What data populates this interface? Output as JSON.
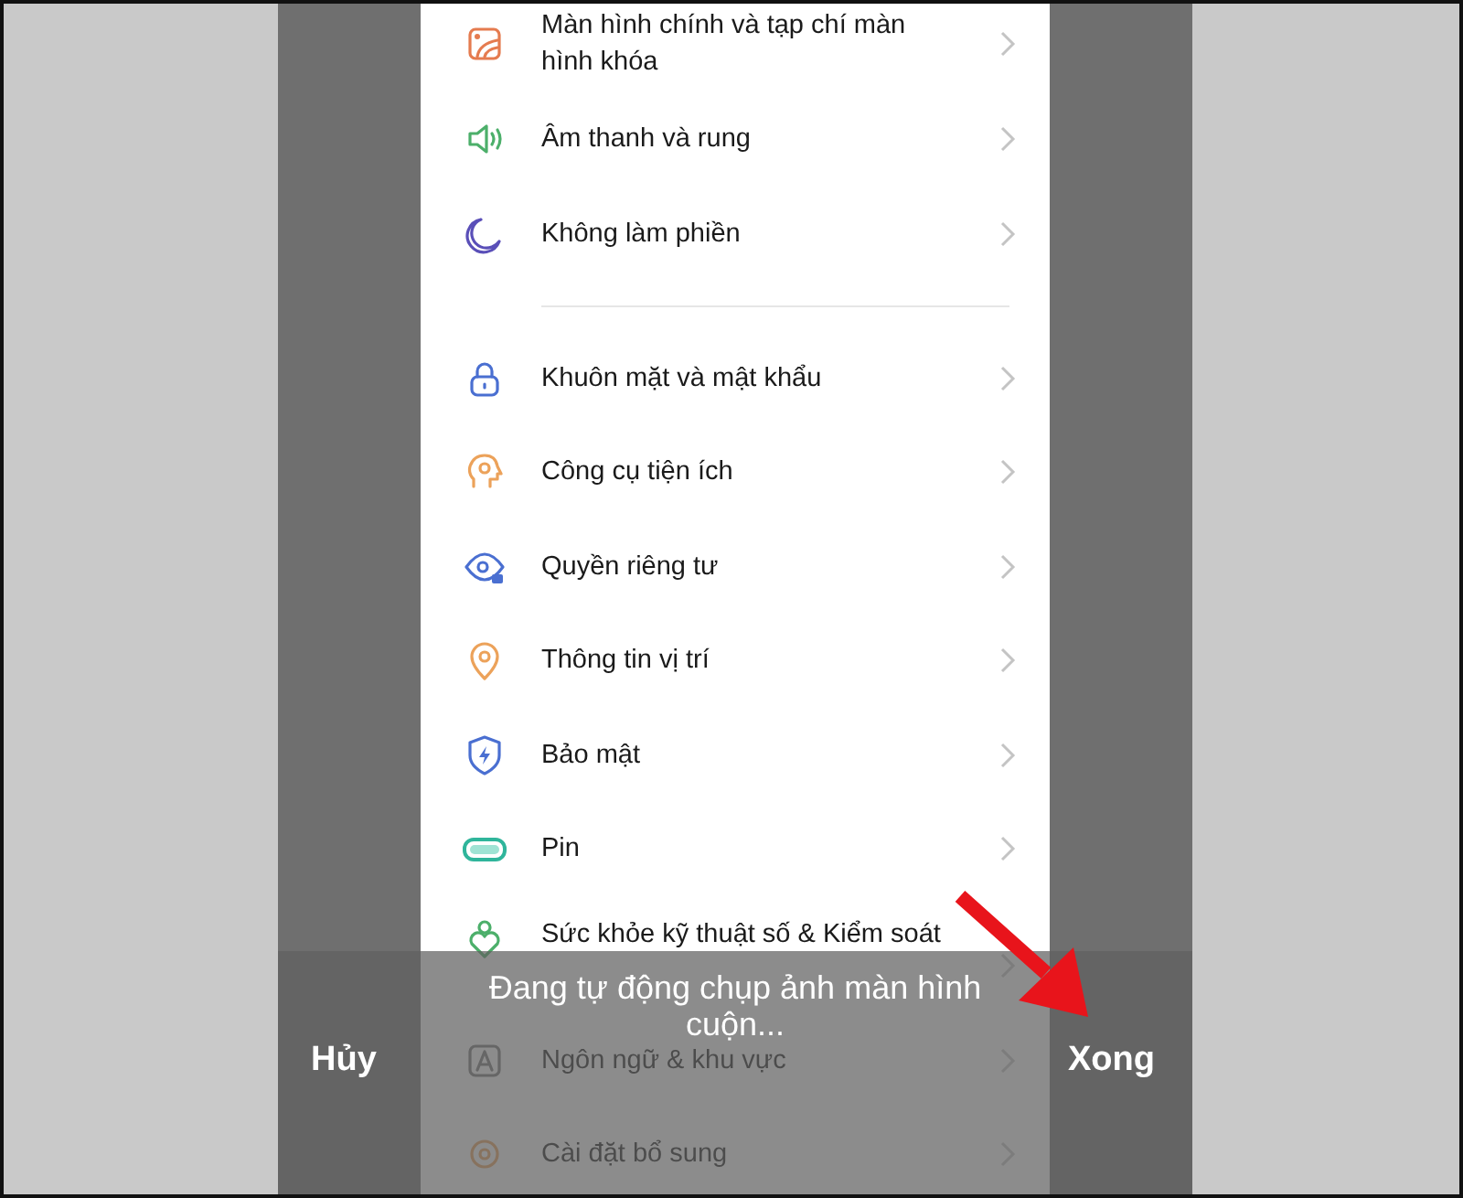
{
  "settings": {
    "groups": [
      {
        "items": [
          {
            "label": "Màn hình chính và tạp chí màn hình khóa"
          },
          {
            "label": "Âm thanh và rung"
          },
          {
            "label": "Không làm phiền"
          }
        ]
      },
      {
        "items": [
          {
            "label": "Khuôn mặt và mật khẩu"
          },
          {
            "label": "Công cụ tiện ích"
          },
          {
            "label": "Quyền riêng tư"
          },
          {
            "label": "Thông tin vị trí"
          },
          {
            "label": "Bảo mật"
          },
          {
            "label": "Pin"
          },
          {
            "label": "Sức khỏe kỹ thuật số & Kiểm soát"
          },
          {
            "label": "Ngôn ngữ & khu vực"
          },
          {
            "label": "Cài đặt bổ sung"
          }
        ]
      }
    ]
  },
  "capture_overlay": {
    "message": "Đang tự động chụp ảnh màn hình cuộn...",
    "cancel": "Hủy",
    "done": "Xong"
  }
}
